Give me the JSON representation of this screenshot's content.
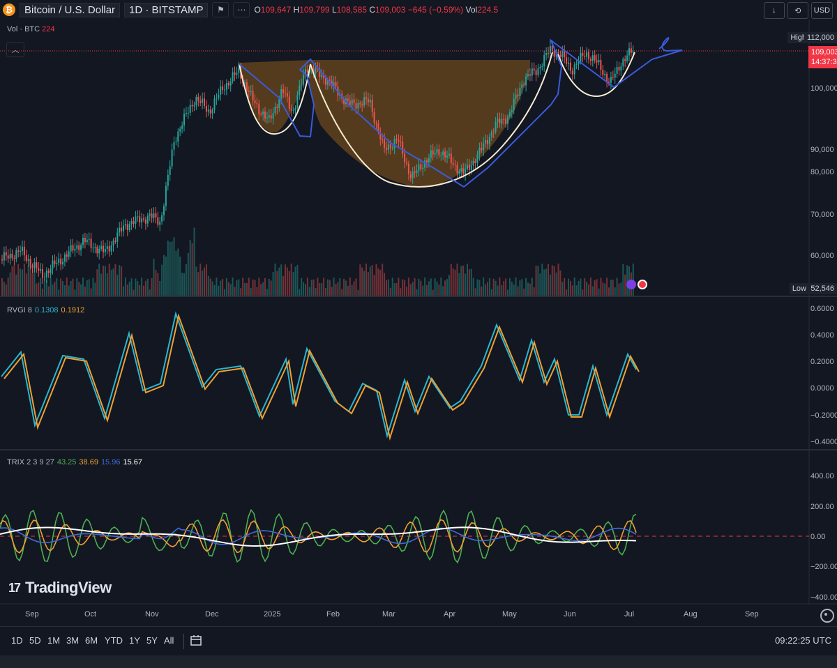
{
  "header": {
    "logo_glyph": "₿",
    "symbol_title": "Bitcoin / U.S. Dollar",
    "interval_exchange": "1D · BITSTAMP",
    "open_key": "O",
    "open_val": "109,647",
    "high_key": "H",
    "high_val": "109,799",
    "low_key": "L",
    "low_val": "108,585",
    "close_key": "C",
    "close_val": "109,003",
    "change": "−645 (−0.59%)",
    "vol_key": "Vol",
    "vol_val": "224.5",
    "more_glyph": "⋯",
    "flag_glyph": "⚑"
  },
  "toolbar_right": {
    "download_glyph": "↓",
    "replay_glyph": "⟲",
    "currency": "USD"
  },
  "volume_legend": {
    "label": "Vol · BTC",
    "value": "224"
  },
  "collapse_glyph": "︿",
  "price_axis": {
    "labels": [
      "100,000",
      "90,000",
      "80,000",
      "70,000",
      "60,000"
    ],
    "high_label": "High",
    "high_value": "112,000",
    "current_price": "109,003",
    "countdown": "14:37:3",
    "low_label": "Low",
    "low_value": "52,546"
  },
  "rvgi": {
    "name": "RVGI 8",
    "value1": "0.1308",
    "value2": "0.1912",
    "axis": [
      "0.6000",
      "0.4000",
      "0.2000",
      "0.0000",
      "−0.2000",
      "−0.4000"
    ]
  },
  "trix": {
    "name": "TRIX 2 3 9 27",
    "v1": "43.25",
    "v2": "38.69",
    "v3": "15.96",
    "v4": "15.67",
    "axis": [
      "400.00",
      "200.00",
      "0.00",
      "−200.00",
      "−400.00"
    ]
  },
  "time_axis": [
    "Sep",
    "Oct",
    "Nov",
    "Dec",
    "2025",
    "Feb",
    "Mar",
    "Apr",
    "May",
    "Jun",
    "Jul",
    "Aug",
    "Sep"
  ],
  "ranges": [
    "1D",
    "5D",
    "1M",
    "3M",
    "6M",
    "YTD",
    "1Y",
    "5Y",
    "All"
  ],
  "clock": "09:22:25 UTC",
  "brand": {
    "name": "TradingView",
    "mark": "17"
  },
  "colors": {
    "up": "#26a69a",
    "down": "#ef5350",
    "bg": "#131722",
    "rvgi_line": "#2bb6cf",
    "rvgi_signal": "#f0a030",
    "trix_green": "#4caf50",
    "trix_orange": "#f0a030",
    "trix_blue": "#3d6bd9",
    "trix_white": "#ffffff",
    "drawing_blue": "#3b5bdb",
    "drawing_cream": "#f6ecd1",
    "fill_brown": "#8a5a1c"
  }
}
